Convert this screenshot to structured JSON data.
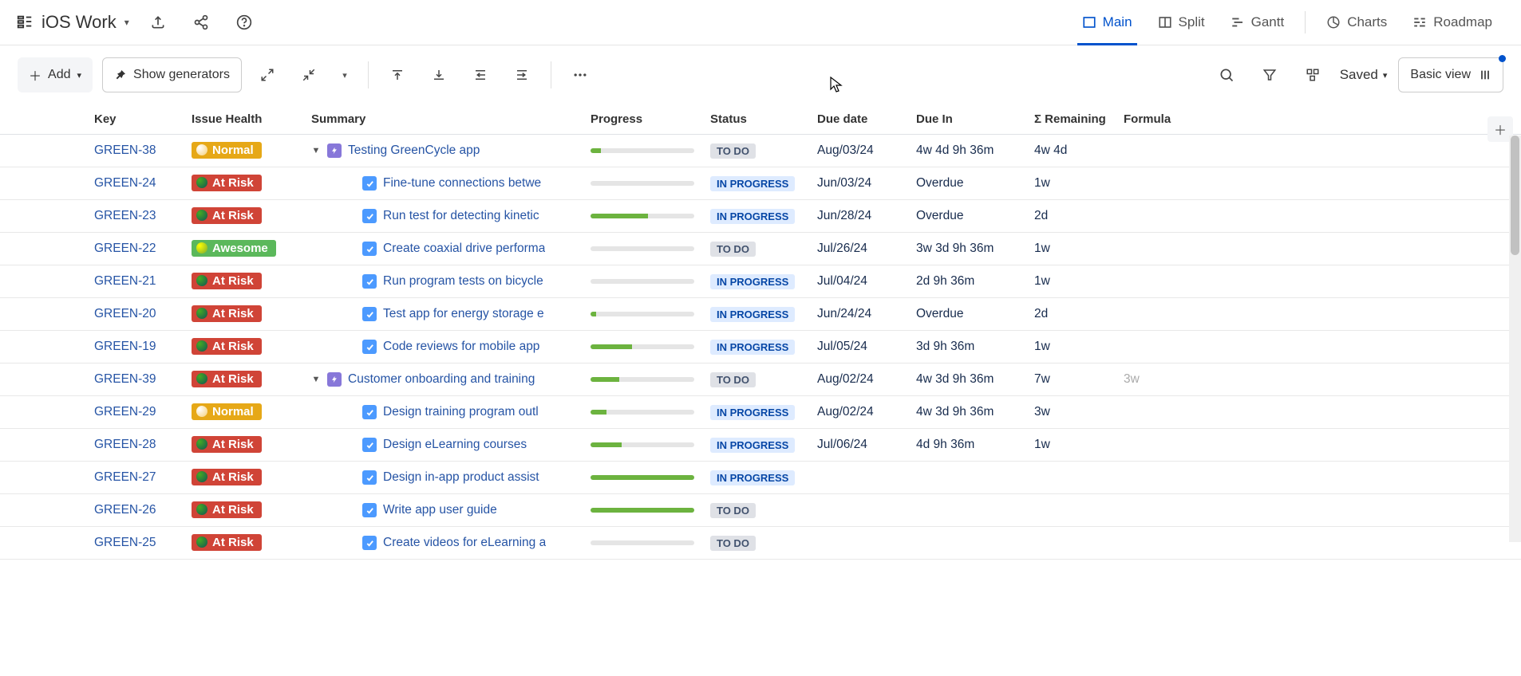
{
  "header": {
    "title": "iOS Work",
    "tabs": [
      {
        "id": "main",
        "label": "Main",
        "active": true
      },
      {
        "id": "split",
        "label": "Split",
        "active": false
      },
      {
        "id": "gantt",
        "label": "Gantt",
        "active": false
      },
      {
        "id": "charts",
        "label": "Charts",
        "active": false
      },
      {
        "id": "roadmap",
        "label": "Roadmap",
        "active": false
      }
    ]
  },
  "toolbar": {
    "add_label": "Add",
    "show_generators_label": "Show generators",
    "saved_label": "Saved",
    "basic_view_label": "Basic view"
  },
  "columns": {
    "key": "Key",
    "health": "Issue Health",
    "summary": "Summary",
    "progress": "Progress",
    "status": "Status",
    "due": "Due date",
    "duein": "Due In",
    "remain": "Σ Remaining",
    "formula": "Formula"
  },
  "rows": [
    {
      "key": "GREEN-38",
      "health": "Normal",
      "healthType": "normal",
      "indent": 0,
      "hasChildren": true,
      "epic": true,
      "summary": "Testing GreenCycle app",
      "progress": 10,
      "status": "TO DO",
      "due": "Aug/03/24",
      "duein": "4w 4d 9h 36m",
      "remain": "4w 4d",
      "formula": ""
    },
    {
      "key": "GREEN-24",
      "health": "At Risk",
      "healthType": "risk",
      "indent": 1,
      "hasChildren": false,
      "epic": false,
      "summary": "Fine-tune connections betwe",
      "progress": 0,
      "status": "IN PROGRESS",
      "due": "Jun/03/24",
      "duein": "Overdue",
      "remain": "1w",
      "formula": ""
    },
    {
      "key": "GREEN-23",
      "health": "At Risk",
      "healthType": "risk",
      "indent": 1,
      "hasChildren": false,
      "epic": false,
      "summary": "Run test for detecting kinetic",
      "progress": 55,
      "status": "IN PROGRESS",
      "due": "Jun/28/24",
      "duein": "Overdue",
      "remain": "2d",
      "formula": ""
    },
    {
      "key": "GREEN-22",
      "health": "Awesome",
      "healthType": "awesome",
      "indent": 1,
      "hasChildren": false,
      "epic": false,
      "summary": "Create coaxial drive performa",
      "progress": 0,
      "status": "TO DO",
      "due": "Jul/26/24",
      "duein": "3w 3d 9h 36m",
      "remain": "1w",
      "formula": ""
    },
    {
      "key": "GREEN-21",
      "health": "At Risk",
      "healthType": "risk",
      "indent": 1,
      "hasChildren": false,
      "epic": false,
      "summary": "Run program tests on bicycle",
      "progress": 0,
      "status": "IN PROGRESS",
      "due": "Jul/04/24",
      "duein": "2d 9h 36m",
      "remain": "1w",
      "formula": ""
    },
    {
      "key": "GREEN-20",
      "health": "At Risk",
      "healthType": "risk",
      "indent": 1,
      "hasChildren": false,
      "epic": false,
      "summary": "Test app for energy storage e",
      "progress": 5,
      "status": "IN PROGRESS",
      "due": "Jun/24/24",
      "duein": "Overdue",
      "remain": "2d",
      "formula": ""
    },
    {
      "key": "GREEN-19",
      "health": "At Risk",
      "healthType": "risk",
      "indent": 1,
      "hasChildren": false,
      "epic": false,
      "summary": "Code reviews for mobile app",
      "progress": 40,
      "status": "IN PROGRESS",
      "due": "Jul/05/24",
      "duein": "3d 9h 36m",
      "remain": "1w",
      "formula": ""
    },
    {
      "key": "GREEN-39",
      "health": "At Risk",
      "healthType": "risk",
      "indent": 0,
      "hasChildren": true,
      "epic": true,
      "summary": "Customer onboarding and training",
      "progress": 28,
      "status": "TO DO",
      "due": "Aug/02/24",
      "duein": "4w 3d 9h 36m",
      "remain": "7w",
      "formula": "3w"
    },
    {
      "key": "GREEN-29",
      "health": "Normal",
      "healthType": "normal",
      "indent": 1,
      "hasChildren": false,
      "epic": false,
      "summary": "Design training program outl",
      "progress": 15,
      "status": "IN PROGRESS",
      "due": "Aug/02/24",
      "duein": "4w 3d 9h 36m",
      "remain": "3w",
      "formula": ""
    },
    {
      "key": "GREEN-28",
      "health": "At Risk",
      "healthType": "risk",
      "indent": 1,
      "hasChildren": false,
      "epic": false,
      "summary": "Design eLearning courses",
      "progress": 30,
      "status": "IN PROGRESS",
      "due": "Jul/06/24",
      "duein": "4d 9h 36m",
      "remain": "1w",
      "formula": ""
    },
    {
      "key": "GREEN-27",
      "health": "At Risk",
      "healthType": "risk",
      "indent": 1,
      "hasChildren": false,
      "epic": false,
      "summary": "Design in-app product assist",
      "progress": 100,
      "status": "IN PROGRESS",
      "due": "",
      "duein": "",
      "remain": "",
      "formula": ""
    },
    {
      "key": "GREEN-26",
      "health": "At Risk",
      "healthType": "risk",
      "indent": 1,
      "hasChildren": false,
      "epic": false,
      "summary": "Write app user guide",
      "progress": 100,
      "status": "TO DO",
      "due": "",
      "duein": "",
      "remain": "",
      "formula": ""
    },
    {
      "key": "GREEN-25",
      "health": "At Risk",
      "healthType": "risk",
      "indent": 1,
      "hasChildren": false,
      "epic": false,
      "summary": "Create videos for eLearning a",
      "progress": 0,
      "status": "TO DO",
      "due": "",
      "duein": "",
      "remain": "",
      "formula": ""
    }
  ]
}
